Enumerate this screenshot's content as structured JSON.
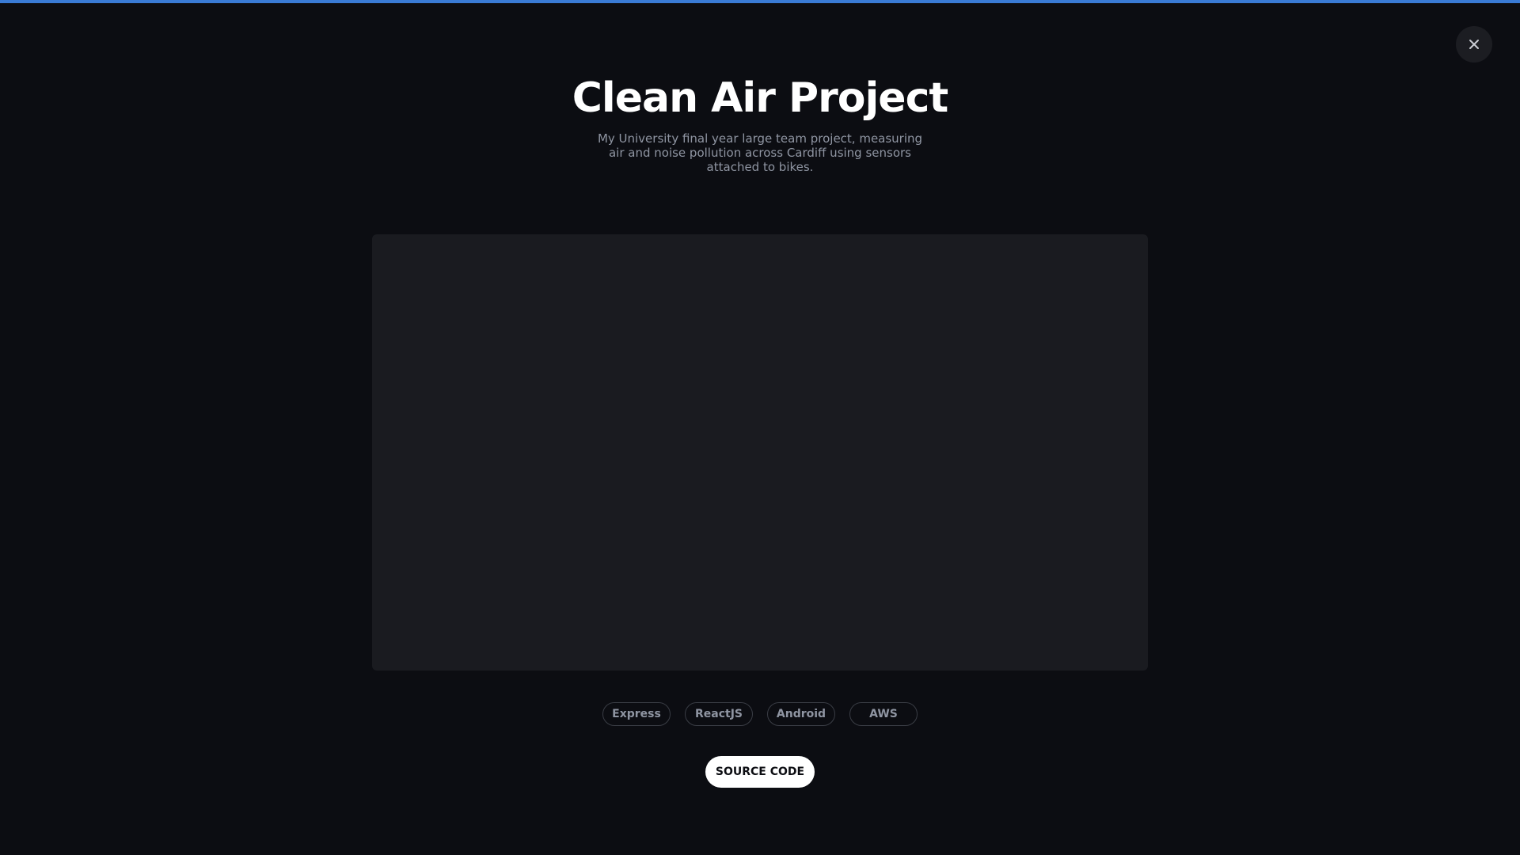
{
  "colors": {
    "background": "#0c0d12",
    "accent": "#3a7bd5",
    "title": "#ffffff",
    "muted_text": "#8f95a2",
    "media_placeholder": "#1a1b20",
    "button_bg": "#ffffff"
  },
  "close_button": {
    "icon": "close-icon"
  },
  "project": {
    "title": "Clean Air Project",
    "description": "My University final year large team project, measuring air and noise pollution across Cardiff using sensors attached to bikes."
  },
  "tags": [
    "Express",
    "ReactJS",
    "Android",
    "AWS"
  ],
  "actions": {
    "source_code_label": "SOURCE CODE"
  }
}
